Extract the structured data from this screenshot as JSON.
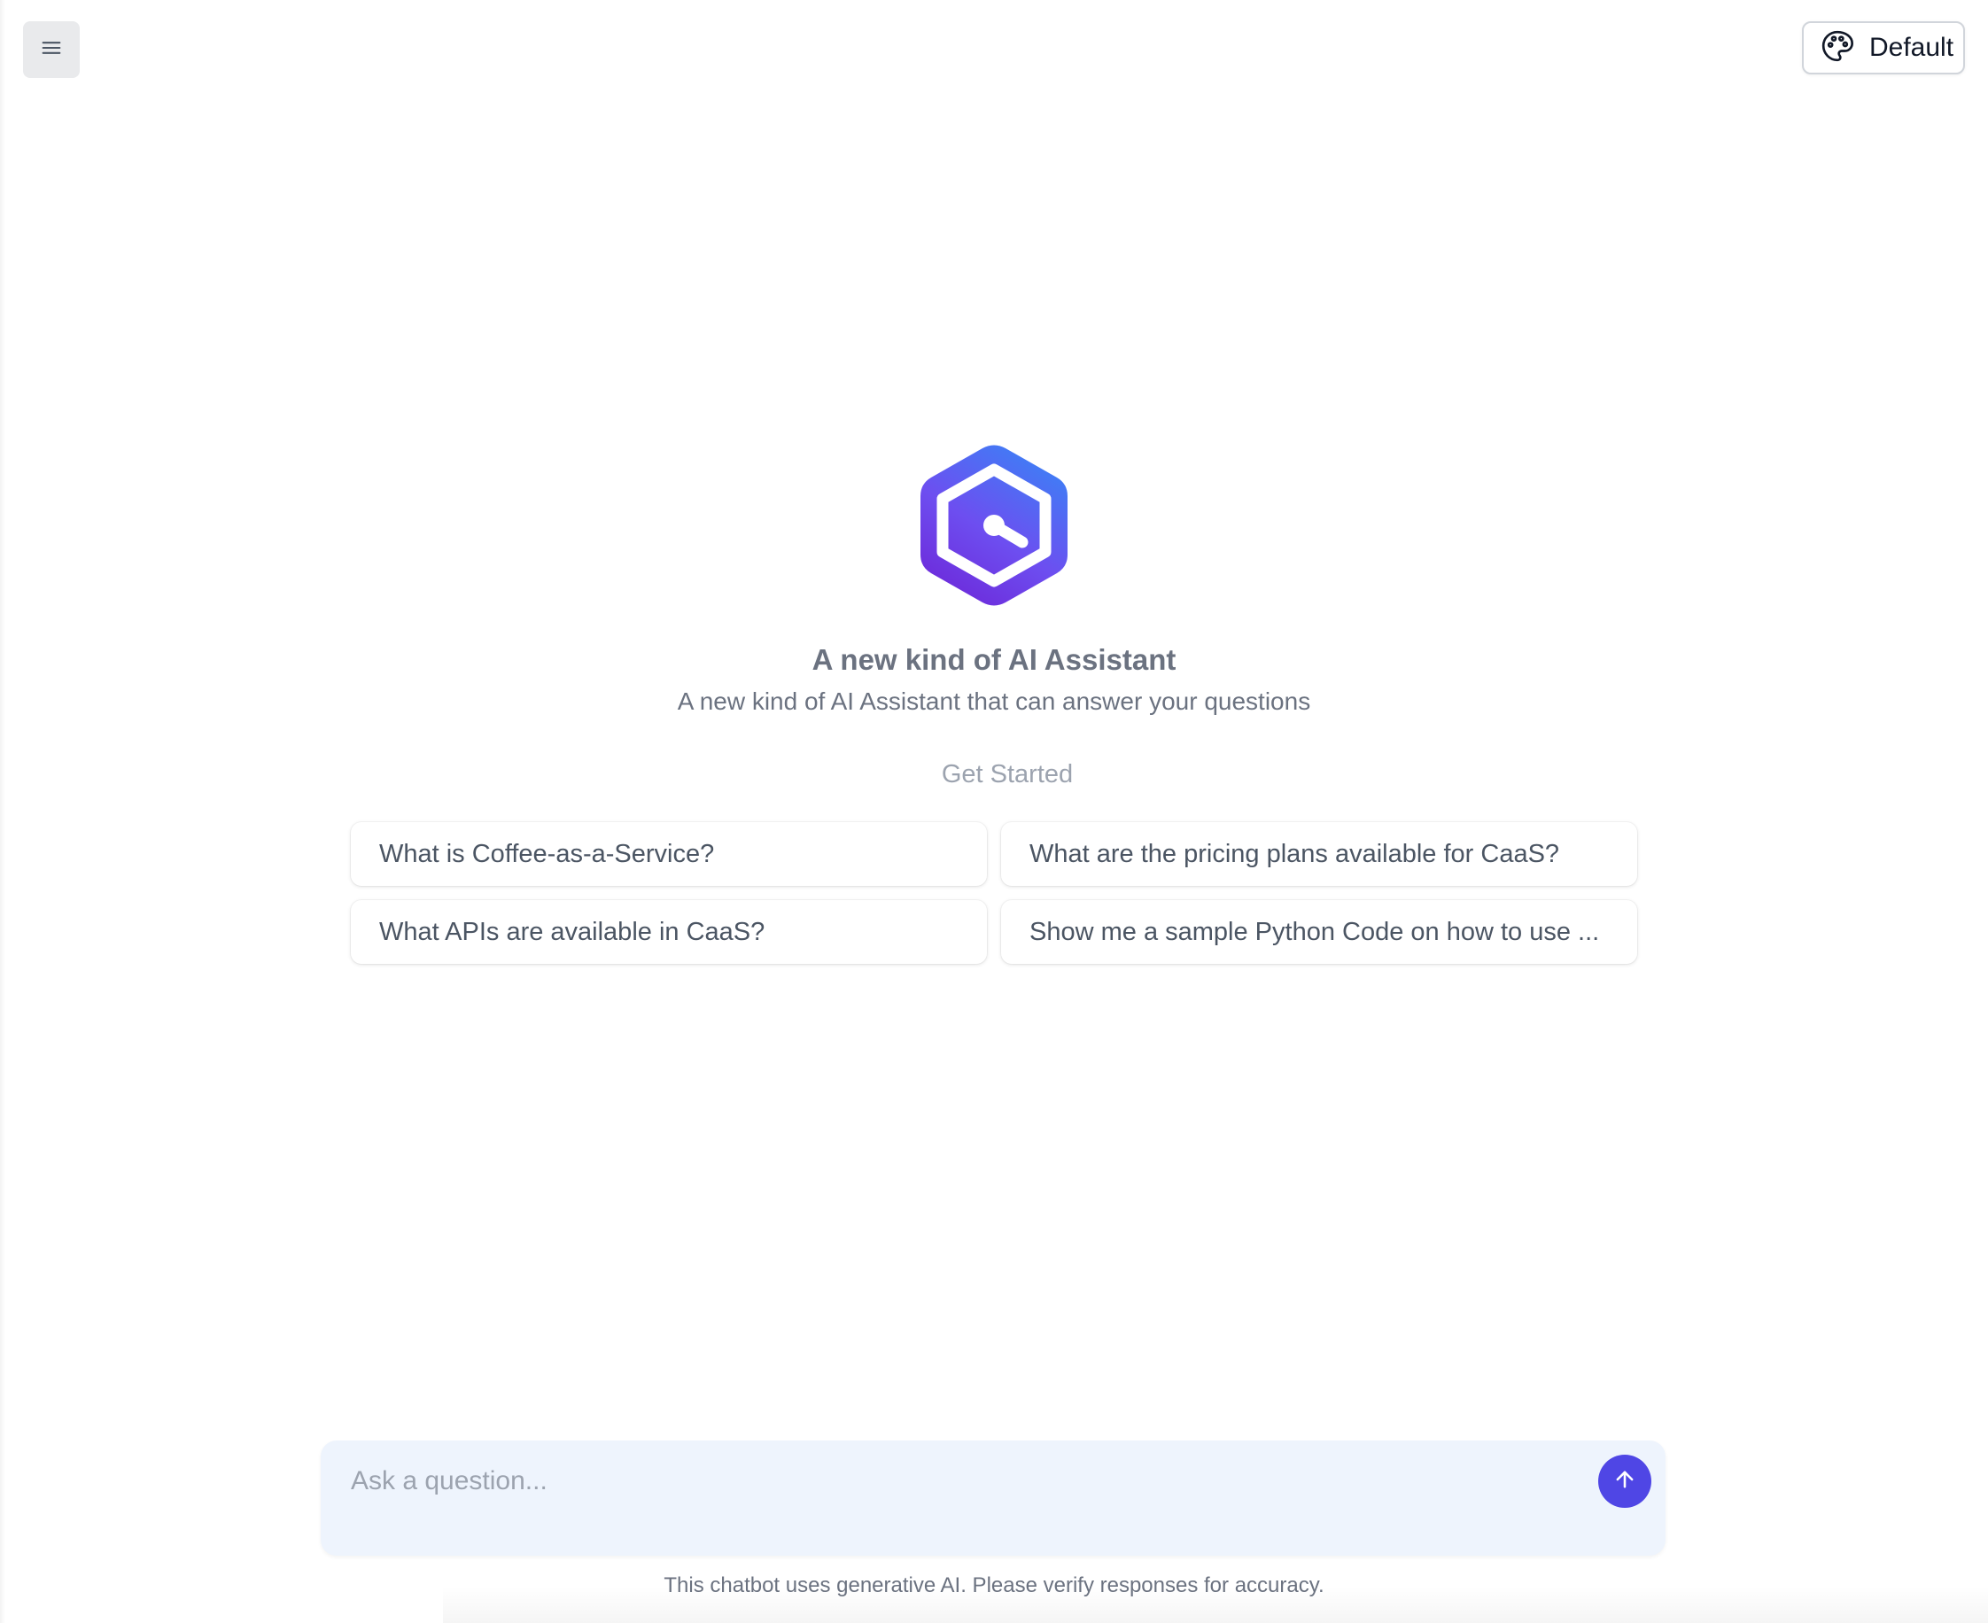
{
  "header": {
    "menu_icon": "hamburger-menu-icon",
    "theme": {
      "icon": "palette-icon",
      "label": "Default"
    }
  },
  "hero": {
    "logo": "hexagon-logo",
    "title": "A new kind of AI Assistant",
    "subtitle": "A new kind of AI Assistant that can answer your questions"
  },
  "get_started": {
    "label": "Get Started",
    "suggestions": [
      "What is Coffee-as-a-Service?",
      "What are the pricing plans available for CaaS?",
      "What APIs are available in CaaS?",
      "Show me a sample Python Code on how to use ..."
    ]
  },
  "chat_input": {
    "placeholder": "Ask a question...",
    "value": "",
    "send_icon": "arrow-up-icon"
  },
  "footer": {
    "disclaimer": "This chatbot uses generative AI. Please verify responses for accuracy."
  },
  "colors": {
    "accent": "#4f46e5",
    "input_background": "#eef4fd",
    "logo_gradient_start": "#3b82f6",
    "logo_gradient_end": "#7c3aed"
  }
}
